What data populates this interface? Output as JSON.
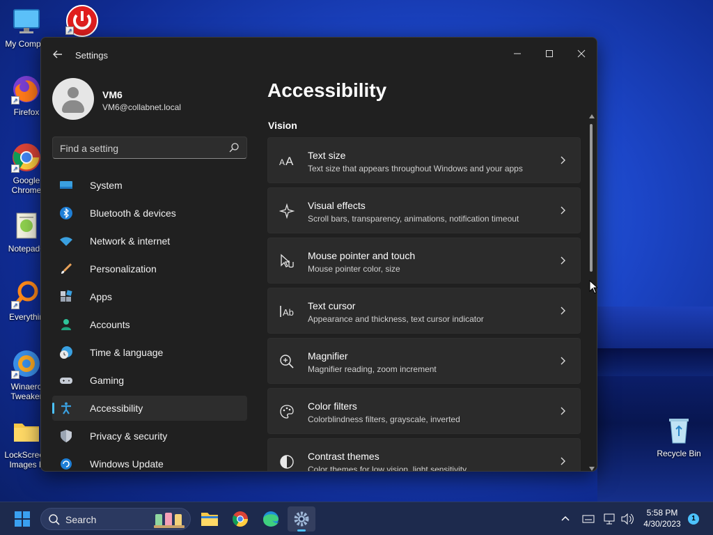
{
  "desktop": {
    "icons": [
      {
        "label": "My Comput"
      },
      {
        "label": "Firefox"
      },
      {
        "label": "Google Chrome"
      },
      {
        "label": "Notepad+"
      },
      {
        "label": "Everythin"
      },
      {
        "label": "Winaero Tweaker"
      },
      {
        "label": "LockScreen Images b"
      },
      {
        "label": "Recycle Bin"
      }
    ]
  },
  "window": {
    "title": "Settings",
    "controls": {
      "minimize": "—",
      "maximize": "☐",
      "close": "✕"
    }
  },
  "user": {
    "name": "VM6",
    "email": "VM6@collabnet.local"
  },
  "search": {
    "placeholder": "Find a setting"
  },
  "nav": {
    "items": [
      {
        "label": "System",
        "icon": "system-icon"
      },
      {
        "label": "Bluetooth & devices",
        "icon": "bluetooth-icon"
      },
      {
        "label": "Network & internet",
        "icon": "wifi-icon"
      },
      {
        "label": "Personalization",
        "icon": "brush-icon"
      },
      {
        "label": "Apps",
        "icon": "apps-icon"
      },
      {
        "label": "Accounts",
        "icon": "accounts-icon"
      },
      {
        "label": "Time & language",
        "icon": "globe-clock-icon"
      },
      {
        "label": "Gaming",
        "icon": "gamepad-icon"
      },
      {
        "label": "Accessibility",
        "icon": "accessibility-icon",
        "active": true
      },
      {
        "label": "Privacy & security",
        "icon": "shield-icon"
      },
      {
        "label": "Windows Update",
        "icon": "update-icon"
      }
    ]
  },
  "main": {
    "title": "Accessibility",
    "section": "Vision",
    "cards": [
      {
        "title": "Text size",
        "desc": "Text size that appears throughout Windows and your apps",
        "icon": "text-size-icon"
      },
      {
        "title": "Visual effects",
        "desc": "Scroll bars, transparency, animations, notification timeout",
        "icon": "visual-effects-icon"
      },
      {
        "title": "Mouse pointer and touch",
        "desc": "Mouse pointer color, size",
        "icon": "mouse-pointer-icon"
      },
      {
        "title": "Text cursor",
        "desc": "Appearance and thickness, text cursor indicator",
        "icon": "text-cursor-icon"
      },
      {
        "title": "Magnifier",
        "desc": "Magnifier reading, zoom increment",
        "icon": "magnifier-icon"
      },
      {
        "title": "Color filters",
        "desc": "Colorblindness filters, grayscale, inverted",
        "icon": "palette-icon"
      },
      {
        "title": "Contrast themes",
        "desc": "Color themes for low vision, light sensitivity",
        "icon": "contrast-icon"
      }
    ]
  },
  "taskbar": {
    "search_label": "Search",
    "time": "5:58 PM",
    "date": "4/30/2023",
    "notification_count": "1"
  },
  "colors": {
    "accent": "#4cc2ff",
    "window_bg": "#202020",
    "card_bg": "#2b2b2b"
  }
}
